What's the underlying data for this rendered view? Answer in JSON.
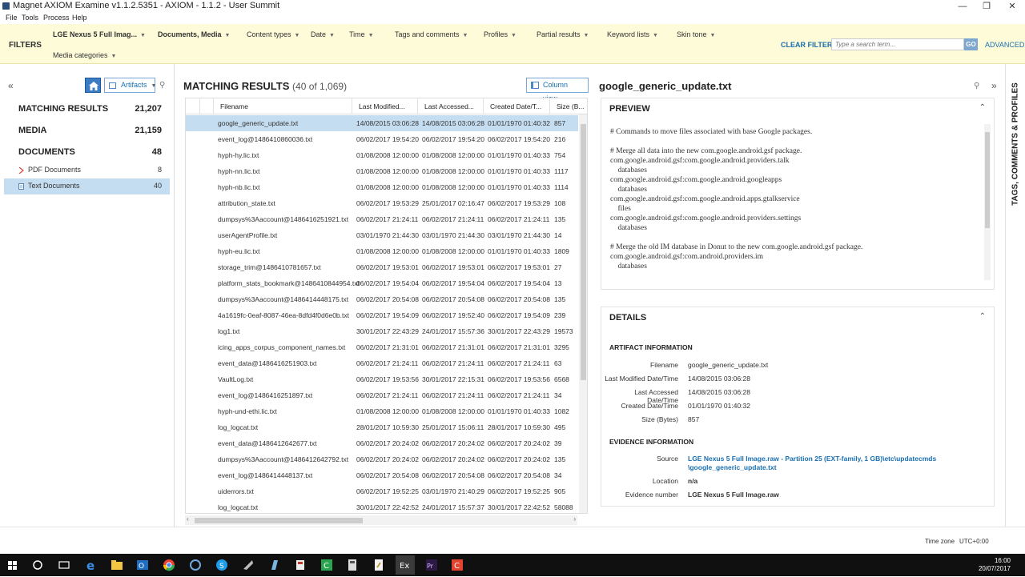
{
  "window": {
    "title": "Magnet AXIOM Examine v1.1.2.5351 - AXIOM - 1.1.2 - User Summit",
    "minimize": "—",
    "maximize": "❐",
    "close": "✕"
  },
  "menu": [
    "File",
    "Tools",
    "Process",
    "Help"
  ],
  "filters": {
    "title": "FILTERS",
    "items": [
      "LGE Nexus 5 Full Imag...",
      "Documents, Media",
      "Content types",
      "Date",
      "Time",
      "Tags and comments",
      "Profiles",
      "Partial results",
      "Keyword lists",
      "Skin tone",
      "Media categories"
    ],
    "clear": "CLEAR FILTERS",
    "search_placeholder": "Type a search term...",
    "go": "GO",
    "advanced": "ADVANCED"
  },
  "left": {
    "collapse": "«",
    "artifacts_label": "Artifacts",
    "nav": [
      {
        "label": "MATCHING RESULTS",
        "count": "21,207"
      },
      {
        "label": "MEDIA",
        "count": "21,159"
      },
      {
        "label": "DOCUMENTS",
        "count": "48"
      }
    ],
    "sub": [
      {
        "label": "PDF Documents",
        "count": "8"
      },
      {
        "label": "Text Documents",
        "count": "40"
      }
    ]
  },
  "center": {
    "title": "MATCHING RESULTS",
    "count": "(40 of 1,069)",
    "column_view": "Column view",
    "columns": [
      "Filename",
      "Last Modified...",
      "Last Accessed...",
      "Created Date/T...",
      "Size (B..."
    ],
    "rows": [
      [
        "google_generic_update.txt",
        "14/08/2015 03:06:28",
        "14/08/2015 03:06:28",
        "01/01/1970 01:40:32",
        "857"
      ],
      [
        "event_log@1486410860036.txt",
        "06/02/2017 19:54:20",
        "06/02/2017 19:54:20",
        "06/02/2017 19:54:20",
        "216"
      ],
      [
        "hyph-hy.lic.txt",
        "01/08/2008 12:00:00",
        "01/08/2008 12:00:00",
        "01/01/1970 01:40:33",
        "754"
      ],
      [
        "hyph-nn.lic.txt",
        "01/08/2008 12:00:00",
        "01/08/2008 12:00:00",
        "01/01/1970 01:40:33",
        "1117"
      ],
      [
        "hyph-nb.lic.txt",
        "01/08/2008 12:00:00",
        "01/08/2008 12:00:00",
        "01/01/1970 01:40:33",
        "1114"
      ],
      [
        "attribution_state.txt",
        "06/02/2017 19:53:29",
        "25/01/2017 02:16:47",
        "06/02/2017 19:53:29",
        "108"
      ],
      [
        "dumpsys%3Aaccount@1486416251921.txt",
        "06/02/2017 21:24:11",
        "06/02/2017 21:24:11",
        "06/02/2017 21:24:11",
        "135"
      ],
      [
        "userAgentProfile.txt",
        "03/01/1970 21:44:30",
        "03/01/1970 21:44:30",
        "03/01/1970 21:44:30",
        "14"
      ],
      [
        "hyph-eu.lic.txt",
        "01/08/2008 12:00:00",
        "01/08/2008 12:00:00",
        "01/01/1970 01:40:33",
        "1809"
      ],
      [
        "storage_trim@1486410781657.txt",
        "06/02/2017 19:53:01",
        "06/02/2017 19:53:01",
        "06/02/2017 19:53:01",
        "27"
      ],
      [
        "platform_stats_bookmark@1486410844954.txt",
        "06/02/2017 19:54:04",
        "06/02/2017 19:54:04",
        "06/02/2017 19:54:04",
        "13"
      ],
      [
        "dumpsys%3Aaccount@1486414448175.txt",
        "06/02/2017 20:54:08",
        "06/02/2017 20:54:08",
        "06/02/2017 20:54:08",
        "135"
      ],
      [
        "4a1619fc-0eaf-8087-46ea-8dfd4f0d6e0b.txt",
        "06/02/2017 19:54:09",
        "06/02/2017 19:52:40",
        "06/02/2017 19:54:09",
        "239"
      ],
      [
        "log1.txt",
        "30/01/2017 22:43:29",
        "24/01/2017 15:57:36",
        "30/01/2017 22:43:29",
        "19573"
      ],
      [
        "icing_apps_corpus_component_names.txt",
        "06/02/2017 21:31:01",
        "06/02/2017 21:31:01",
        "06/02/2017 21:31:01",
        "3295"
      ],
      [
        "event_data@1486416251903.txt",
        "06/02/2017 21:24:11",
        "06/02/2017 21:24:11",
        "06/02/2017 21:24:11",
        "63"
      ],
      [
        "VaultLog.txt",
        "06/02/2017 19:53:56",
        "30/01/2017 22:15:31",
        "06/02/2017 19:53:56",
        "6568"
      ],
      [
        "event_log@1486416251897.txt",
        "06/02/2017 21:24:11",
        "06/02/2017 21:24:11",
        "06/02/2017 21:24:11",
        "34"
      ],
      [
        "hyph-und-ethi.lic.txt",
        "01/08/2008 12:00:00",
        "01/08/2008 12:00:00",
        "01/01/1970 01:40:33",
        "1082"
      ],
      [
        "log_logcat.txt",
        "28/01/2017 10:59:30",
        "25/01/2017 15:06:11",
        "28/01/2017 10:59:30",
        "495"
      ],
      [
        "event_data@1486412642677.txt",
        "06/02/2017 20:24:02",
        "06/02/2017 20:24:02",
        "06/02/2017 20:24:02",
        "39"
      ],
      [
        "dumpsys%3Aaccount@1486412642792.txt",
        "06/02/2017 20:24:02",
        "06/02/2017 20:24:02",
        "06/02/2017 20:24:02",
        "135"
      ],
      [
        "event_log@1486414448137.txt",
        "06/02/2017 20:54:08",
        "06/02/2017 20:54:08",
        "06/02/2017 20:54:08",
        "34"
      ],
      [
        "uiderrors.txt",
        "06/02/2017 19:52:25",
        "03/01/1970 21:40:29",
        "06/02/2017 19:52:25",
        "905"
      ],
      [
        "log_logcat.txt",
        "30/01/2017 22:42:52",
        "24/01/2017 15:57:37",
        "30/01/2017 22:42:52",
        "58088"
      ]
    ]
  },
  "right": {
    "filename": "google_generic_update.txt",
    "preview_title": "PREVIEW",
    "preview_lines": [
      "# Commands to move files associated with base Google packages.",
      "",
      "# Merge all data into the new com.google.android.gsf package.",
      "com.google.android.gsf:com.google.android.providers.talk",
      "    databases",
      "com.google.android.gsf:com.google.android.googleapps",
      "    databases",
      "com.google.android.gsf:com.google.android.apps.gtalkservice",
      "    files",
      "com.google.android.gsf:com.google.android.providers.settings",
      "    databases",
      "",
      "# Merge the old IM database in Donut to the new com.google.android.gsf package.",
      "com.google.android.gsf:com.android.providers.im",
      "    databases"
    ],
    "details_title": "DETAILS",
    "artifact_info_title": "ARTIFACT INFORMATION",
    "artifact_info": [
      {
        "k": "Filename",
        "v": "google_generic_update.txt"
      },
      {
        "k": "Last Modified Date/Time",
        "v": "14/08/2015 03:06:28"
      },
      {
        "k": "Last Accessed Date/Time",
        "v": "14/08/2015 03:06:28"
      },
      {
        "k": "Created Date/Time",
        "v": "01/01/1970 01:40:32"
      },
      {
        "k": "Size (Bytes)",
        "v": "857"
      }
    ],
    "evidence_info_title": "EVIDENCE INFORMATION",
    "evidence_source_label": "Source",
    "evidence_source_line1": "LGE Nexus 5 Full Image.raw - Partition 25 (EXT-family, 1 GB)\\etc\\updatecmds",
    "evidence_source_line2": "\\google_generic_update.txt",
    "evidence_location_label": "Location",
    "evidence_location": "n/a",
    "evidence_number_label": "Evidence number",
    "evidence_number": "LGE Nexus 5 Full Image.raw"
  },
  "sidetab": "TAGS, COMMENTS & PROFILES",
  "status": {
    "tz_label": "Time zone",
    "tz_value": "UTC+0:00"
  },
  "clock": {
    "time": "16:00",
    "date": "20/07/2017"
  },
  "colors": {
    "filter_bg": "#fdfbd8",
    "selected_row": "#c5ddf0",
    "accent": "#1a6fb0"
  }
}
